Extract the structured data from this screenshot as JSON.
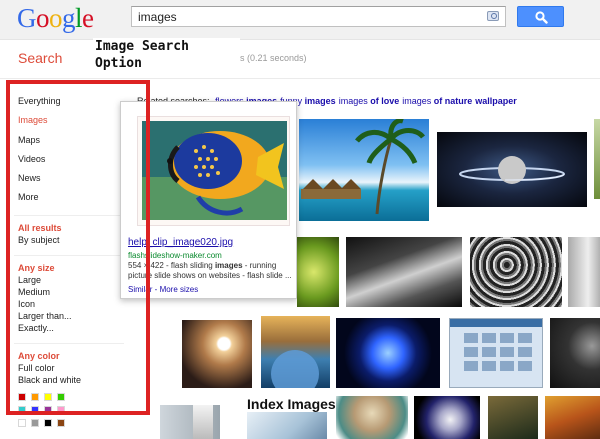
{
  "header": {
    "logo_letters": [
      {
        "ch": "G",
        "color": "#3369e8"
      },
      {
        "ch": "o",
        "color": "#d50f25"
      },
      {
        "ch": "o",
        "color": "#eeb211"
      },
      {
        "ch": "g",
        "color": "#3369e8"
      },
      {
        "ch": "l",
        "color": "#009925"
      },
      {
        "ch": "e",
        "color": "#d50f25"
      }
    ],
    "search_value": "images",
    "camera_icon": "camera-icon",
    "search_button_icon": "magnifier-icon"
  },
  "subheader": {
    "search_label": "Search",
    "annotation": "Image Search\nOption",
    "result_stats": "s (0.21 seconds)"
  },
  "sidebar": {
    "nav": [
      {
        "label": "Everything",
        "active": false
      },
      {
        "label": "Images",
        "active": true
      },
      {
        "label": "Maps",
        "active": false
      },
      {
        "label": "Videos",
        "active": false
      },
      {
        "label": "News",
        "active": false
      },
      {
        "label": "More",
        "active": false
      }
    ],
    "results": {
      "head": "All results",
      "items": [
        "By subject"
      ]
    },
    "size": {
      "head": "Any size",
      "items": [
        "Large",
        "Medium",
        "Icon",
        "Larger than...",
        "Exactly..."
      ]
    },
    "color": {
      "head": "Any color",
      "items": [
        "Full color",
        "Black and white"
      ],
      "swatches": [
        "#cc0000",
        "#ff9900",
        "#ffff00",
        "#33cc00",
        "#33cccc",
        "#3333ff",
        "#993399",
        "#ff99cc",
        "#ffffff",
        "#999999",
        "#000000",
        "#8b4513"
      ]
    }
  },
  "related": {
    "prefix": "Related searches:",
    "links": [
      {
        "pre": "flowers",
        "bold": "images"
      },
      {
        "pre": "funny",
        "bold": "images"
      },
      {
        "pre": "images",
        "bold": "of love"
      },
      {
        "pre": "images",
        "bold": "of nature"
      },
      {
        "pre": "",
        "bold": "wallpaper"
      }
    ]
  },
  "hover_card": {
    "title": "help_clip_image020.jpg",
    "url": "flashslideshow-maker.com",
    "desc_pre": "554 × 422 - flash sliding ",
    "desc_bold": "images",
    "desc_post": " - running picture slide shows on websites - flash slide ...",
    "similar": "Similar",
    "separator": " - ",
    "more_sizes": "More sizes"
  },
  "grid": {
    "index_title": "Index Images"
  }
}
